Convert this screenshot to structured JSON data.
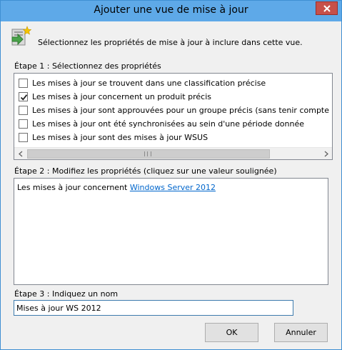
{
  "window": {
    "title": "Ajouter une vue de mise à jour"
  },
  "header": {
    "description": "Sélectionnez les propriétés de mise à jour à inclure dans cette vue."
  },
  "step1": {
    "label": "Étape 1 : Sélectionnez des propriétés",
    "items": [
      {
        "label": "Les mises à jour se trouvent dans une classification précise",
        "checked": false
      },
      {
        "label": "Les mises à jour concernent un produit précis",
        "checked": true
      },
      {
        "label": "Les mises à jour sont approuvées pour un groupe précis (sans tenir compte des a",
        "checked": false
      },
      {
        "label": "Les mises à jour ont été synchronisées au sein d'une période donnée",
        "checked": false
      },
      {
        "label": "Les mises à jour sont des mises à jour WSUS",
        "checked": false
      }
    ]
  },
  "step2": {
    "label": "Étape 2 : Modifiez les propriétés (cliquez sur une valeur soulignée)",
    "text": "Les mises à jour concernent ",
    "link": "Windows Server 2012"
  },
  "step3": {
    "label": "Étape 3 : Indiquez un nom",
    "value": "Mises à jour WS 2012"
  },
  "buttons": {
    "ok": "OK",
    "cancel": "Annuler"
  }
}
